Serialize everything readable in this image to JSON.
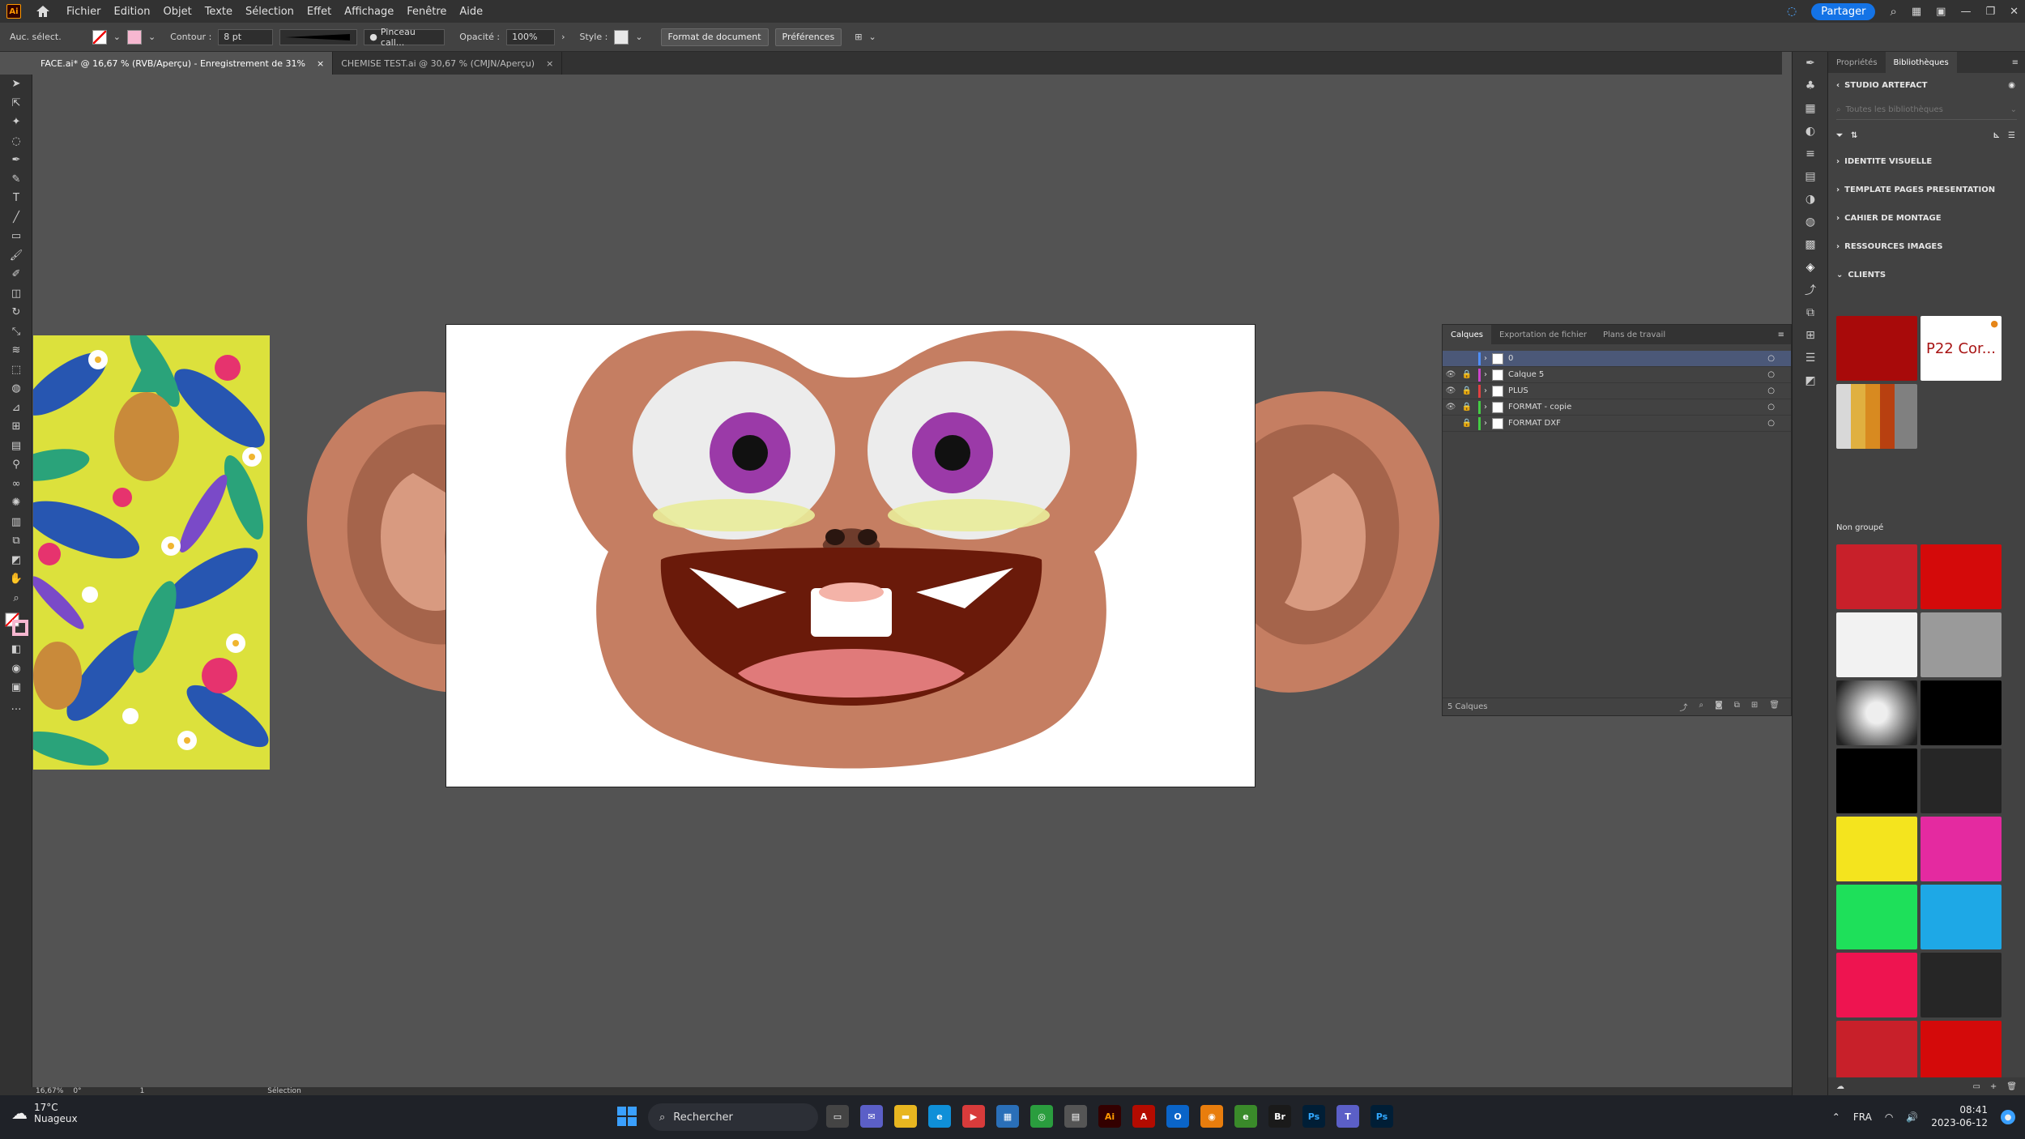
{
  "app": {
    "logo": "Ai"
  },
  "menu": [
    "Fichier",
    "Edition",
    "Objet",
    "Texte",
    "Sélection",
    "Effet",
    "Affichage",
    "Fenêtre",
    "Aide"
  ],
  "menubar_right": {
    "share": "Partager"
  },
  "control": {
    "selection_label": "Auc. sélect.",
    "contour_label": "Contour :",
    "stroke_weight": "8 pt",
    "brush": "Pinceau call...",
    "opacity_label": "Opacité :",
    "opacity_value": "100%",
    "style_label": "Style :",
    "doc_format_btn": "Format de document",
    "prefs_btn": "Préférences"
  },
  "tabs": [
    {
      "label": "FACE.ai* @ 16,67 % (RVB/Aperçu)  - Enregistrement de 31%",
      "active": true
    },
    {
      "label": "CHEMISE TEST.ai @ 30,67 % (CMJN/Aperçu)",
      "active": false
    }
  ],
  "layers_panel": {
    "tabs": [
      "Calques",
      "Exportation de fichier",
      "Plans de travail"
    ],
    "layers": [
      {
        "name": "0",
        "color": "#4f8ff7",
        "visible": false,
        "locked": false,
        "selected": true
      },
      {
        "name": "Calque 5",
        "color": "#cc44cc",
        "visible": true,
        "locked": true,
        "selected": false
      },
      {
        "name": "PLUS",
        "color": "#e04040",
        "visible": true,
        "locked": true,
        "selected": false
      },
      {
        "name": "FORMAT - copie",
        "color": "#44cc44",
        "visible": true,
        "locked": true,
        "selected": false
      },
      {
        "name": "FORMAT DXF",
        "color": "#44cc44",
        "visible": false,
        "locked": true,
        "selected": false
      }
    ],
    "footer": "5 Calques"
  },
  "right_panel": {
    "tabs": [
      "Propriétés",
      "Bibliothèques"
    ],
    "library": "STUDIO ARTEFACT",
    "search_placeholder": "Toutes les bibliothèques",
    "sections": [
      "IDENTITE VISUELLE",
      "TEMPLATE PAGES PRESENTATION",
      "CAHIER DE MONTAGE",
      "RESSOURCES IMAGES",
      "CLIENTS"
    ],
    "client_text": "P22 Cor...",
    "ungrouped": "Non groupé",
    "swatches": [
      "#c8202a",
      "#d40a0a",
      "#f2f2f2",
      "#9a9a9a",
      "#c0c0c0",
      "#000000",
      "#000000",
      "#262626",
      "#f4e41e",
      "#e42aa0",
      "#1ee05a",
      "#1ea8e6",
      "#ee1450",
      "#262626",
      "#c8202a",
      "#d40a0a",
      "#fff7a0"
    ]
  },
  "status": {
    "zoom": "16,67%",
    "angle": "0°",
    "artboard": "1",
    "tool": "Sélection"
  },
  "taskbar": {
    "temp": "17°C",
    "weather": "Nuageux",
    "search": "Rechercher",
    "lang": "FRA",
    "time": "08:41",
    "date": "2023-06-12"
  }
}
